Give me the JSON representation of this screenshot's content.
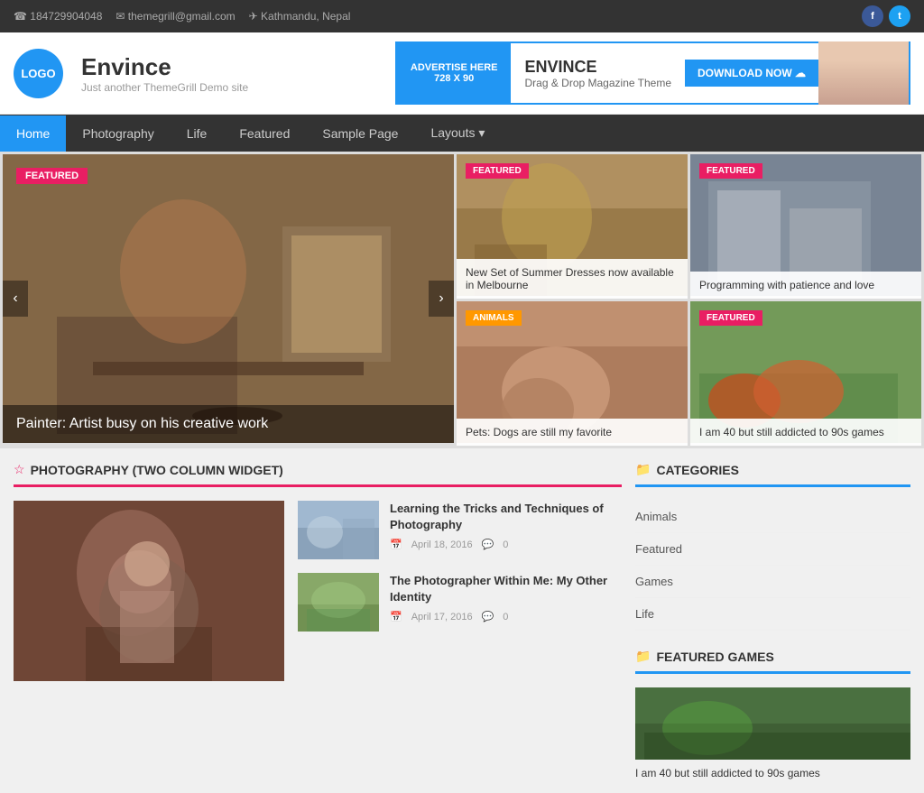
{
  "topbar": {
    "phone": "☎ 184729904048",
    "email": "✉ themegrill@gmail.com",
    "location": "✈ Kathmandu, Nepal",
    "social": {
      "facebook_label": "f",
      "twitter_label": "t"
    }
  },
  "header": {
    "logo_text": "LOGO",
    "site_name": "Envince",
    "site_tagline": "Just another ThemeGrill Demo site",
    "ad_label": "ADVERTISE HERE\n728 X 90",
    "brand_name": "ENVINCE",
    "brand_tagline": "Drag & Drop Magazine Theme",
    "download_btn": "DOWNLOAD NOW ☁"
  },
  "nav": {
    "items": [
      {
        "label": "Home",
        "active": true
      },
      {
        "label": "Photography",
        "active": false
      },
      {
        "label": "Life",
        "active": false
      },
      {
        "label": "Featured",
        "active": false
      },
      {
        "label": "Sample Page",
        "active": false
      },
      {
        "label": "Layouts ▾",
        "active": false
      }
    ]
  },
  "hero": {
    "main": {
      "badge": "FEATURED",
      "caption": "Painter: Artist busy on his creative work"
    },
    "cards": [
      {
        "badge": "FEATURED",
        "badge_type": "pink",
        "caption": "New Set of Summer Dresses now available in Melbourne"
      },
      {
        "badge": "FEATURED",
        "badge_type": "pink",
        "caption": "Programming with patience and love"
      },
      {
        "badge": "ANIMALS",
        "badge_type": "orange",
        "caption": "Pets: Dogs are still my favorite"
      },
      {
        "badge": "FEATURED",
        "badge_type": "pink",
        "caption": "I am 40 but still addicted to 90s games"
      }
    ],
    "prev_btn": "‹",
    "next_btn": "›"
  },
  "photography_widget": {
    "title": "PHOTOGRAPHY (TWO COLUMN WIDGET)",
    "articles": [
      {
        "title": "Learning the Tricks and Techniques of Photography",
        "date": "April 18, 2016",
        "comments": "0"
      },
      {
        "title": "The Photographer Within Me: My Other Identity",
        "date": "April 17, 2016",
        "comments": "0"
      }
    ]
  },
  "sidebar": {
    "categories_title": "CATEGORIES",
    "categories": [
      {
        "label": "Animals"
      },
      {
        "label": "Featured"
      },
      {
        "label": "Games"
      },
      {
        "label": "Life"
      }
    ],
    "featured_games_title": "Featured Games"
  }
}
